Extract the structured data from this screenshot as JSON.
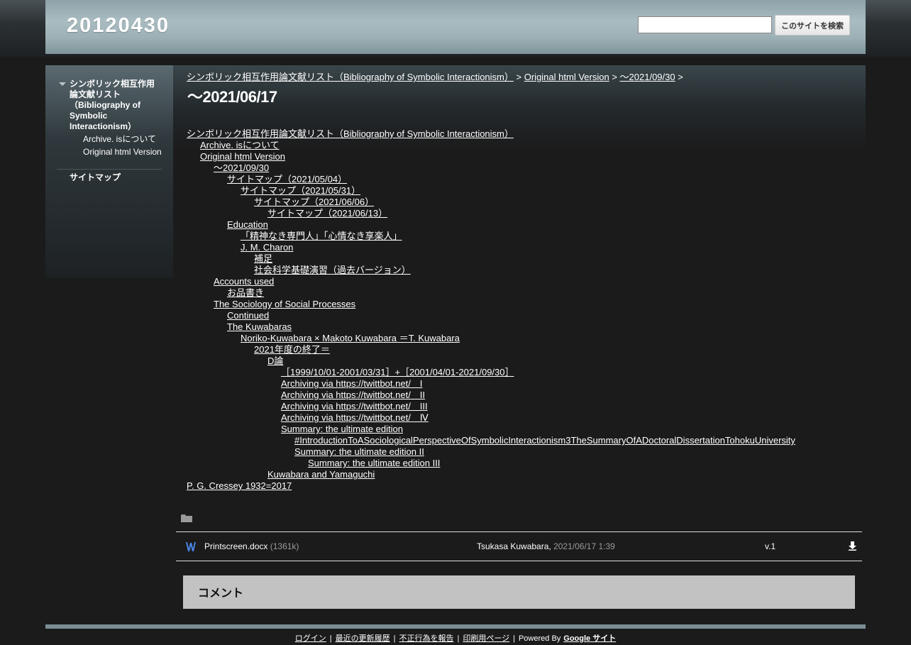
{
  "site": {
    "title": "20120430"
  },
  "search": {
    "button_label": "このサイトを検索",
    "value": ""
  },
  "sidebar": {
    "top_item": "シンボリック相互作用論文献リスト（Bibliography of Symbolic Interactionism）",
    "sub_items": [
      "Archive. isについて",
      "Original html Version"
    ],
    "sitemap": "サイトマップ"
  },
  "breadcrumb": {
    "items": [
      "シンボリック相互作用論文献リスト（Bibliography of Symbolic Interactionism）",
      "Original html Version",
      "～2021/09/30"
    ],
    "separator": ">"
  },
  "page": {
    "title": "～2021/06/17"
  },
  "tree": [
    {
      "label": "シンボリック相互作用論文献リスト（Bibliography of Symbolic Interactionism）",
      "level": 0
    },
    {
      "label": "Archive. isについて",
      "level": 1
    },
    {
      "label": "Original html Version",
      "level": 1
    },
    {
      "label": "～2021/09/30",
      "level": 2
    },
    {
      "label": "サイトマップ（2021/05/04）",
      "level": 3
    },
    {
      "label": "サイトマップ（2021/05/31）",
      "level": 4
    },
    {
      "label": "サイトマップ（2021/06/06）",
      "level": 5
    },
    {
      "label": "サイトマップ（2021/06/13）",
      "level": 6
    },
    {
      "label": "Education",
      "level": 3
    },
    {
      "label": "「精神なき専門人」「心情なき享楽人」",
      "level": 4
    },
    {
      "label": "J. M. Charon",
      "level": 4
    },
    {
      "label": "補足",
      "level": 5
    },
    {
      "label": "社会科学基礎演習（過去バージョン）",
      "level": 5
    },
    {
      "label": "Accounts used",
      "level": 2
    },
    {
      "label": "お品書き",
      "level": 3
    },
    {
      "label": "The Sociology of Social Processes",
      "level": 2
    },
    {
      "label": "Continued",
      "level": 3
    },
    {
      "label": "The Kuwabaras",
      "level": 3
    },
    {
      "label": "Noriko-Kuwabara × Makoto Kuwabara ＝T. Kuwabara",
      "level": 4
    },
    {
      "label": "2021年度の終了＝",
      "level": 5
    },
    {
      "label": "D論",
      "level": 6
    },
    {
      "label": "［1999/10/01-2001/03/31］+［2001/04/01-2021/09/30］",
      "level": 7
    },
    {
      "label": "Archiving via https://twittbot.net/　I",
      "level": 7
    },
    {
      "label": "Archiving via https://twittbot.net/　II",
      "level": 7
    },
    {
      "label": "Archiving via https://twittbot.net/　III",
      "level": 7
    },
    {
      "label": "Archiving via https://twittbot.net/　Ⅳ",
      "level": 7
    },
    {
      "label": "Summary: the ultimate edition",
      "level": 7
    },
    {
      "label": "#IntroductionToASociologicalPerspectiveOfSymbolicInteractionism3TheSummaryOfADoctoralDissertationTohokuUniversity",
      "level": 8
    },
    {
      "label": "Summary: the ultimate edition II",
      "level": 8
    },
    {
      "label": "Summary: the ultimate edition III",
      "level": 9
    },
    {
      "label": "Kuwabara and Yamaguchi",
      "level": 6
    },
    {
      "label": "P. G. Cressey 1932=2017",
      "level": 0
    }
  ],
  "attachment": {
    "icon": "word-doc-icon",
    "filename": "Printscreen.docx",
    "size": "(1361k)",
    "author": "Tsukasa Kuwabara,",
    "date": "2021/06/17 1:39",
    "version": "v.1"
  },
  "comments": {
    "title": "コメント"
  },
  "footer": {
    "links": [
      "ログイン",
      "最近の更新履歴",
      "不正行為を報告",
      "印刷用ページ"
    ],
    "powered_by": "Powered By",
    "google": "Google サイト"
  },
  "colors": {
    "header": "#a9bcc1",
    "background": "#1b1b1b",
    "footer_bar": "#7c8e95",
    "comment_box": "#c2c2c2"
  }
}
